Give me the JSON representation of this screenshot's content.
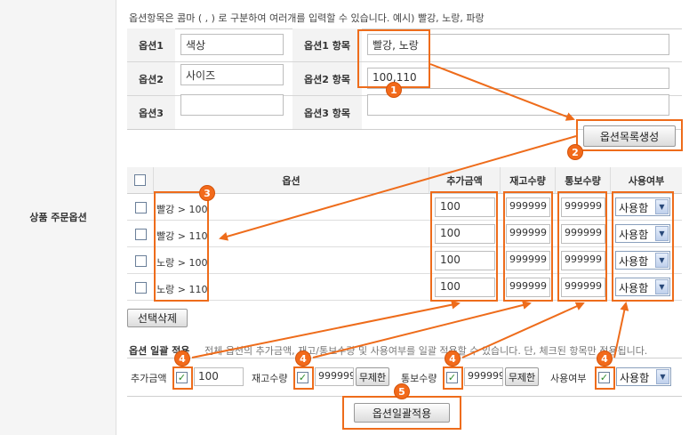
{
  "section_label": "상품 주문옵션",
  "note": "옵션항목은 콤마 ( , ) 로 구분하여 여러개를 입력할 수 있습니다. 예시) 빨강, 노랑, 파랑",
  "options": [
    {
      "label": "옵션1",
      "name": "색상",
      "items_label": "옵션1 항목",
      "items": "빨강, 노랑"
    },
    {
      "label": "옵션2",
      "name": "사이즈",
      "items_label": "옵션2 항목",
      "items": "100,110"
    },
    {
      "label": "옵션3",
      "name": "",
      "items_label": "옵션3 항목",
      "items": ""
    }
  ],
  "generate_button": "옵션목록생성",
  "grid": {
    "headers": {
      "option": "옵션",
      "extra_price": "추가금액",
      "stock_qty": "재고수량",
      "notify_qty": "통보수량",
      "use": "사용여부"
    },
    "rows": [
      {
        "option": "빨강 > 100",
        "extra_price": "100",
        "stock_qty": "999999",
        "notify_qty": "999999",
        "use": "사용함"
      },
      {
        "option": "빨강 > 110",
        "extra_price": "100",
        "stock_qty": "999999",
        "notify_qty": "999999",
        "use": "사용함"
      },
      {
        "option": "노랑 > 100",
        "extra_price": "100",
        "stock_qty": "999999",
        "notify_qty": "999999",
        "use": "사용함"
      },
      {
        "option": "노랑 > 110",
        "extra_price": "100",
        "stock_qty": "999999",
        "notify_qty": "999999",
        "use": "사용함"
      }
    ]
  },
  "delete_selected_button": "선택삭제",
  "bulk": {
    "title": "옵션 일괄 적용",
    "description": "전체 옵션의 추가금액, 재고/통보수량 및 사용여부를 일괄 적용할 수 있습니다. 단, 체크된 항목만 적용됩니다.",
    "extra_price_label": "추가금액",
    "extra_price_value": "100",
    "stock_label": "재고수량",
    "stock_value": "999999",
    "stock_unlimited_button": "무제한",
    "notify_label": "통보수량",
    "notify_value": "999999",
    "notify_unlimited_button": "무제한",
    "use_label": "사용여부",
    "use_value": "사용함",
    "apply_button": "옵션일괄적용"
  },
  "badges": [
    "1",
    "2",
    "3",
    "4",
    "5"
  ],
  "colors": {
    "highlight": "#ee6c1b",
    "checkmark": "#2c8a2c"
  }
}
